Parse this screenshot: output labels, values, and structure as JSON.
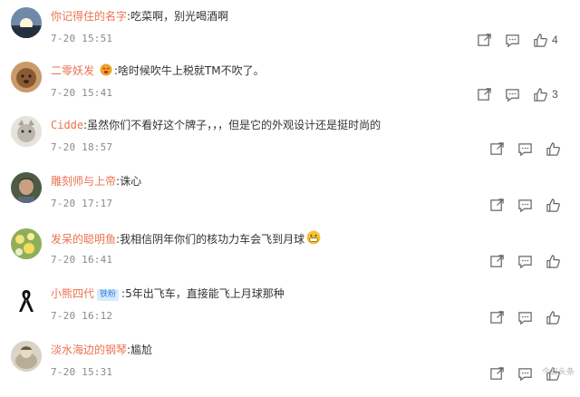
{
  "comments": [
    {
      "username": "你记得住的名字",
      "badge": "",
      "text": "吃菜啊，别光喝酒啊",
      "date": "7-20",
      "time": "15:51",
      "likes": "4"
    },
    {
      "username": "二零妖发",
      "badge": "",
      "text": "啥时候吹牛上税就TM不吹了。",
      "date": "7-20",
      "time": "15:41",
      "likes": "3"
    },
    {
      "username": "Cidde",
      "badge": "",
      "text": "虽然你们不看好这个牌子，，，但是它的外观设计还是挺时尚的",
      "date": "7-20",
      "time": "18:57",
      "likes": ""
    },
    {
      "username": "雕刻师与上帝",
      "badge": "",
      "text": "诛心",
      "date": "7-20",
      "time": "17:17",
      "likes": ""
    },
    {
      "username": "发呆的聪明鱼",
      "badge": "",
      "text": "我相信阴年你们的核功力车会飞到月球",
      "date": "7-20",
      "time": "16:41",
      "likes": ""
    },
    {
      "username": "小熊四代",
      "badge": "铁粉",
      "text": "5年出飞车，直接能飞上月球那种",
      "date": "7-20",
      "time": "16:12",
      "likes": ""
    },
    {
      "username": "淡水海边的钢琴",
      "badge": "",
      "text": "尴尬",
      "date": "7-20",
      "time": "15:31",
      "likes": ""
    }
  ],
  "icons": {
    "share": "share-icon",
    "reply": "comment-icon",
    "like": "thumbs-up-icon"
  },
  "colors": {
    "username": "#eb7350",
    "badge_bg": "#d6ebff",
    "badge_text": "#2f82d6"
  },
  "watermark": "今日头条"
}
